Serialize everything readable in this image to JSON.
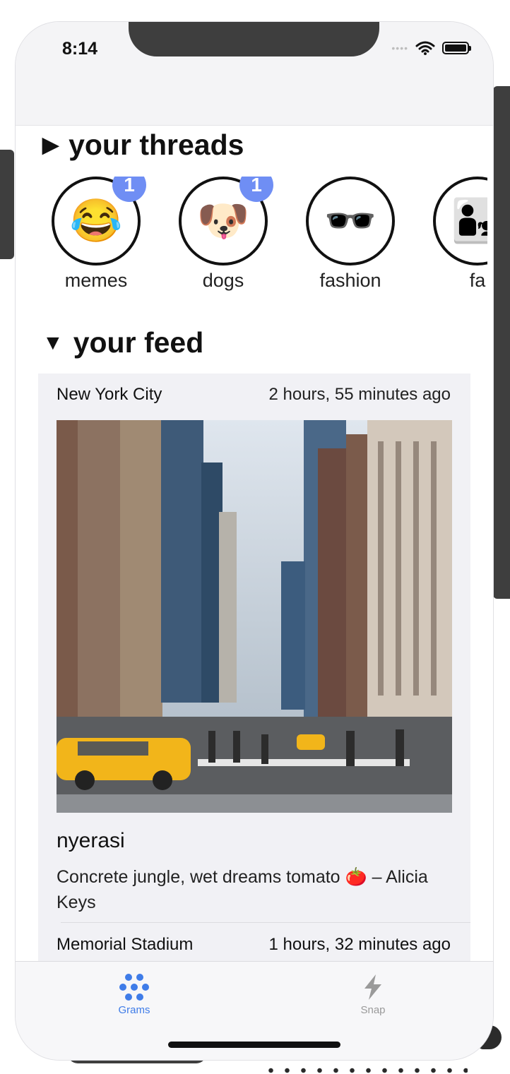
{
  "status_bar": {
    "time": "8:14"
  },
  "threads_section": {
    "title": "your threads",
    "items": [
      {
        "label": "memes",
        "emoji": "😂",
        "badge": "1"
      },
      {
        "label": "dogs",
        "emoji": "🐶",
        "badge": "1"
      },
      {
        "label": "fashion",
        "emoji": "🕶️",
        "badge": ""
      },
      {
        "label": "fa",
        "emoji": "👨‍👧",
        "badge": ""
      }
    ]
  },
  "feed_section": {
    "title": "your feed",
    "posts": [
      {
        "location": "New York City",
        "time": "2 hours, 55 minutes ago",
        "user": "nyerasi",
        "caption": "Concrete jungle, wet dreams tomato 🍅 – Alicia Keys"
      },
      {
        "location": "Memorial Stadium",
        "time": "1 hours, 32 minutes ago"
      }
    ]
  },
  "tab_bar": {
    "tabs": [
      {
        "label": "Grams",
        "icon": "grams-dots-icon",
        "active": true
      },
      {
        "label": "Snap",
        "icon": "lightning-icon",
        "active": false
      }
    ]
  },
  "colors": {
    "accent": "#3f7ce8",
    "badge": "#6f8ef4",
    "card_bg": "#f1f1f5"
  }
}
